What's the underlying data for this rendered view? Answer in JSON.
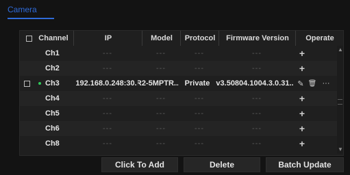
{
  "tab": {
    "label": "Camera"
  },
  "table": {
    "headers": {
      "channel": "Channel",
      "ip": "IP",
      "model": "Model",
      "protocol": "Protocol",
      "firmware": "Firmware Version",
      "operate": "Operate"
    },
    "rows": [
      {
        "channel": "Ch1",
        "ip": "---",
        "model": "---",
        "protocol": "---",
        "firmware": "---",
        "operate": "+"
      },
      {
        "channel": "Ch2",
        "ip": "---",
        "model": "---",
        "protocol": "---",
        "firmware": "---",
        "operate": "+"
      },
      {
        "channel": "Ch3",
        "ip": "192.168.0.248:30.",
        "model": "R2-5MPTR...",
        "protocol": "Private",
        "firmware": "v3.50804.1004.3.0.31..",
        "operate": "",
        "online": true
      },
      {
        "channel": "Ch4",
        "ip": "---",
        "model": "---",
        "protocol": "---",
        "firmware": "---",
        "operate": "+"
      },
      {
        "channel": "Ch5",
        "ip": "---",
        "model": "---",
        "protocol": "---",
        "firmware": "---",
        "operate": "+"
      },
      {
        "channel": "Ch6",
        "ip": "---",
        "model": "---",
        "protocol": "---",
        "firmware": "---",
        "operate": "+"
      },
      {
        "channel": "Ch8",
        "ip": "---",
        "model": "---",
        "protocol": "---",
        "firmware": "---",
        "operate": "+"
      }
    ],
    "row3_icons": {
      "edit": "✎",
      "delete": "🗑",
      "more": "···"
    }
  },
  "buttons": {
    "click_to_add": "Click To Add",
    "delete": "Delete",
    "batch_update": "Batch Update"
  },
  "colors": {
    "accent": "#2f6bd9",
    "online": "#2fc85a"
  }
}
